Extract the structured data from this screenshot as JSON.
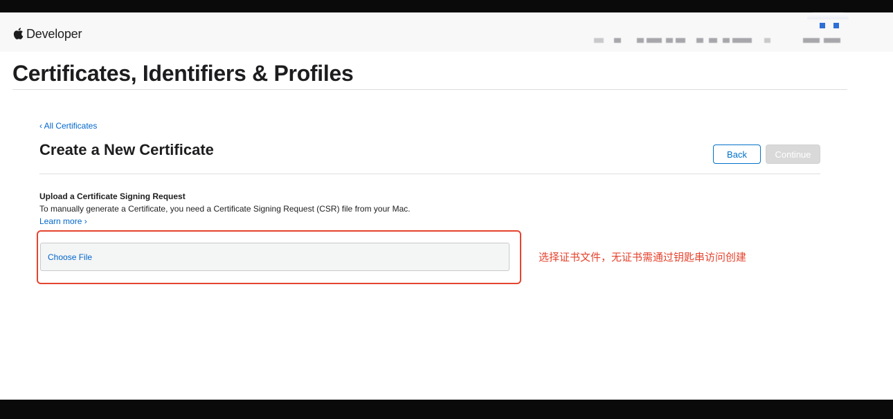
{
  "header": {
    "brand": "Developer",
    "icon": "apple-logo-icon"
  },
  "page": {
    "title": "Certificates, Identifiers & Profiles"
  },
  "content": {
    "back_link": "‹ All Certificates",
    "section_title": "Create a New Certificate",
    "buttons": {
      "back": "Back",
      "continue": "Continue"
    },
    "upload": {
      "heading": "Upload a Certificate Signing Request",
      "description": "To manually generate a Certificate, you need a Certificate Signing Request (CSR) file from your Mac.",
      "learn_more": "Learn more ›",
      "choose_file": "Choose File"
    },
    "annotation": "选择证书文件，无证书需通过钥匙串访问创建"
  },
  "colors": {
    "link": "#0066cc",
    "button_border": "#0070c9",
    "annotation": "#e5432e",
    "disabled_button": "#d9d9d9"
  }
}
